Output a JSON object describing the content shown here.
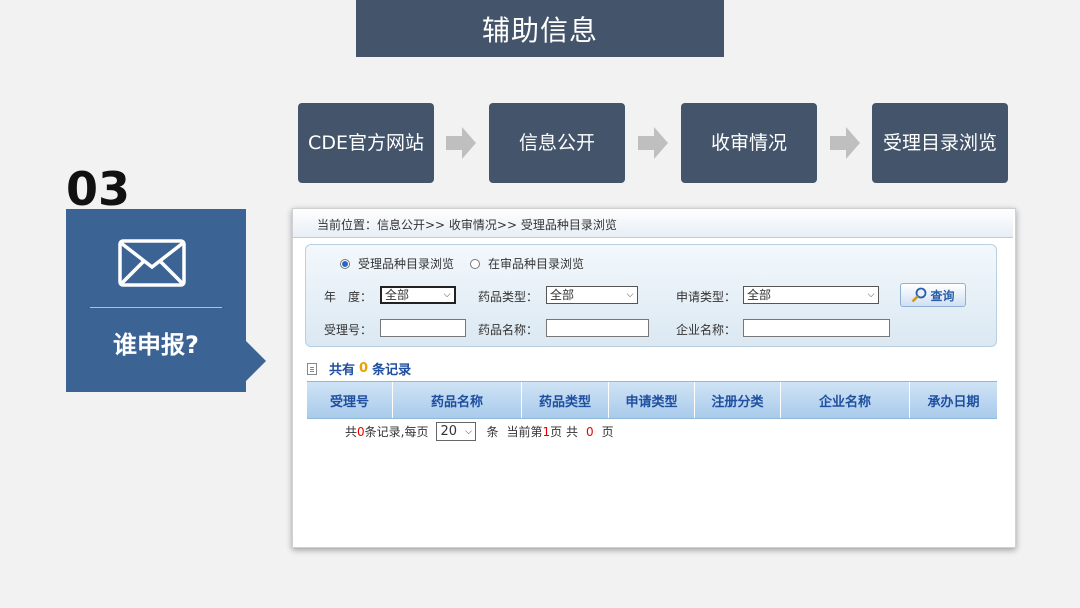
{
  "banner": {
    "title": "辅助信息"
  },
  "flow": {
    "steps": [
      "CDE官方网站",
      "信息公开",
      "收审情况",
      "受理目录浏览"
    ]
  },
  "section": {
    "number": "03",
    "label": "谁申报?"
  },
  "colors": {
    "slate": "#44546a",
    "panel_blue": "#3b6494",
    "link_blue": "#1f4fa0",
    "count_orange": "#e6a400"
  },
  "web": {
    "breadcrumb": "当前位置：信息公开>> 收审情况>> 受理品种目录浏览",
    "radios": [
      {
        "label": "受理品种目录浏览",
        "checked": true
      },
      {
        "label": "在审品种目录浏览",
        "checked": false
      }
    ],
    "filters": {
      "year_label": "年　度：",
      "year_value": "全部",
      "drug_type_label": "药品类型：",
      "drug_type_value": "全部",
      "apply_type_label": "申请类型：",
      "apply_type_value": "全部",
      "accept_no_label": "受理号：",
      "drug_name_label": "药品名称：",
      "company_label": "企业名称："
    },
    "search_button": "查询",
    "records": {
      "prefix": "共有",
      "count": "0",
      "suffix": "条记录"
    },
    "columns": [
      "受理号",
      "药品名称",
      "药品类型",
      "申请类型",
      "注册分类",
      "企业名称",
      "承办日期"
    ],
    "pagination": {
      "total_prefix": "共",
      "total_count": "0",
      "total_suffix": "条记录,每页",
      "page_size": "20",
      "unit": "条",
      "current_prefix": "当前第",
      "current_page": "1",
      "current_suffix": "页 共",
      "page_total": "0",
      "page_unit": "页"
    }
  }
}
